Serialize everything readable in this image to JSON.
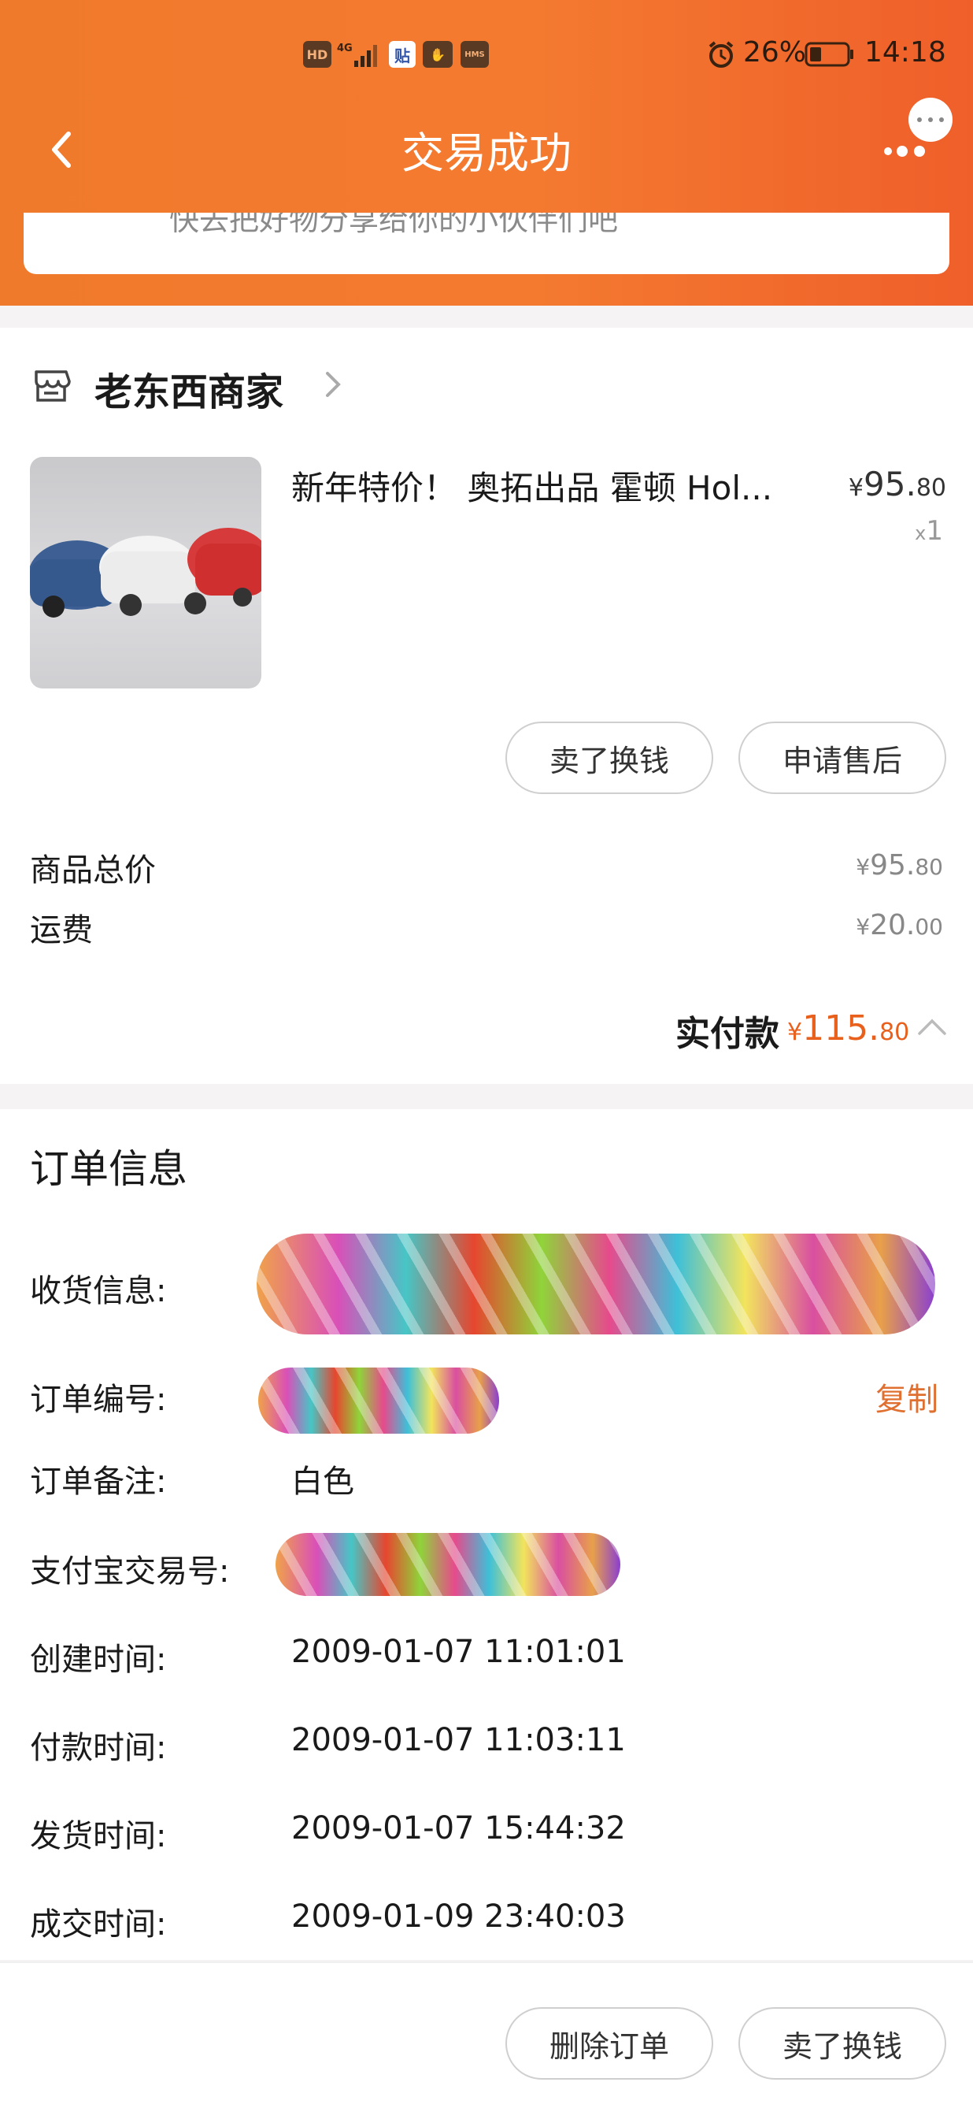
{
  "status_bar": {
    "hd": "HD",
    "network": "4G",
    "battery_percent": "26%",
    "time": "14:18"
  },
  "header": {
    "title": "交易成功",
    "banner_text": "快去把好物分享给你的小伙伴们吧"
  },
  "shop": {
    "name": "老东西商家"
  },
  "product": {
    "title": "新年特价！ 奥拓出品 霍顿 Hol...",
    "price_symbol": "¥",
    "price_int": "95.",
    "price_dec": "80",
    "qty_prefix": "x",
    "qty": "1"
  },
  "item_actions": {
    "sell_label": "卖了换钱",
    "after_sale_label": "申请售后"
  },
  "summary": {
    "goods_total_label": "商品总价",
    "goods_total_symbol": "¥",
    "goods_total_int": "95.",
    "goods_total_dec": "80",
    "shipping_label": "运费",
    "shipping_symbol": "¥",
    "shipping_int": "20.",
    "shipping_dec": "00",
    "paid_label": "实付款",
    "paid_symbol": "¥",
    "paid_int": "115.",
    "paid_dec": "80"
  },
  "order_info": {
    "title": "订单信息",
    "shipping_info_label": "收货信息:",
    "order_no_label": "订单编号:",
    "copy_label": "复制",
    "remark_label": "订单备注:",
    "remark_value": "白色",
    "alipay_label": "支付宝交易号:",
    "created_label": "创建时间:",
    "created_value": "2009-01-07 11:01:01",
    "paid_label": "付款时间:",
    "paid_value": "2009-01-07 11:03:11",
    "shipped_label": "发货时间:",
    "shipped_value": "2009-01-07 15:44:32",
    "completed_label": "成交时间:",
    "completed_value": "2009-01-09 23:40:03"
  },
  "bottom_actions": {
    "delete_label": "删除订单",
    "sell_label": "卖了换钱"
  },
  "colors": {
    "header_orange": "#f07a2c",
    "accent_orange": "#e8601c"
  }
}
